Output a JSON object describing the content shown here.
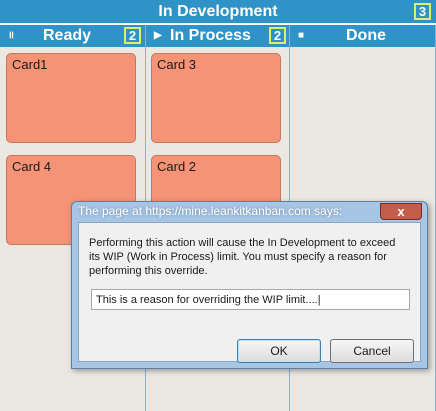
{
  "board": {
    "title": "In Development",
    "wip_limit": "3"
  },
  "lanes": [
    {
      "icon": "pause-icon",
      "icon_glyph": "॥",
      "title": "Ready",
      "wip_limit": "2",
      "cards": [
        "Card1",
        "Card 4"
      ]
    },
    {
      "icon": "play-icon",
      "icon_glyph": "▶",
      "title": "In Process",
      "wip_limit": "2",
      "cards": [
        "Card 3",
        "Card 2"
      ]
    },
    {
      "icon": "stop-icon",
      "icon_glyph": "■",
      "title": "Done",
      "wip_limit": "",
      "cards": []
    }
  ],
  "dialog": {
    "title": "The page at https://mine.leankitkanban.com says:",
    "close_label": "x",
    "message": "Performing this action will cause the In Development to exceed its WIP (Work in Process) limit.  You must specify a reason for performing this override.",
    "input_value": "This is a reason for overriding the WIP limit....|",
    "ok_label": "OK",
    "cancel_label": "Cancel"
  },
  "colors": {
    "header_blue": "#2f93c8",
    "lane_bg": "#ebe7e1",
    "card_fill": "#f49376",
    "wip_badge_border": "#d9f06a"
  }
}
